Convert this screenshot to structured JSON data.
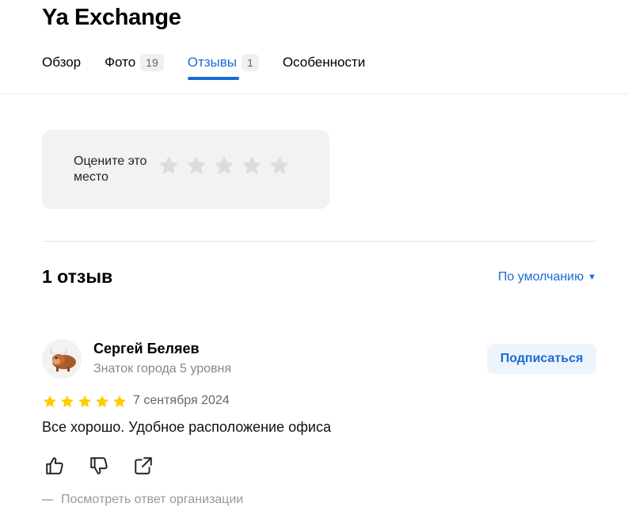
{
  "header": {
    "title": "Ya Exchange",
    "tabs": [
      {
        "label": "Обзор",
        "badge": null,
        "active": false
      },
      {
        "label": "Фото",
        "badge": "19",
        "active": false
      },
      {
        "label": "Отзывы",
        "badge": "1",
        "active": true
      },
      {
        "label": "Особенности",
        "badge": null,
        "active": false
      }
    ]
  },
  "rate": {
    "label": "Оцените это место",
    "stars": 5,
    "star_color": "#dcdcdc"
  },
  "reviews": {
    "count_label": "1 отзыв",
    "sort_label": "По умолчанию",
    "items": [
      {
        "author": "Сергей Беляев",
        "level": "Знаток города 5 уровня",
        "subscribe_label": "Подписаться",
        "rating": 5,
        "date": "7 сентября 2024",
        "text": "Все хорошо. Удобное расположение офиса",
        "org_reply_label": "Посмотреть ответ организации",
        "avatar_icon": "yak-avatar-icon"
      }
    ]
  },
  "colors": {
    "accent": "#1a6bd6",
    "star_filled": "#fc0",
    "star_empty": "#dcdcdc"
  }
}
